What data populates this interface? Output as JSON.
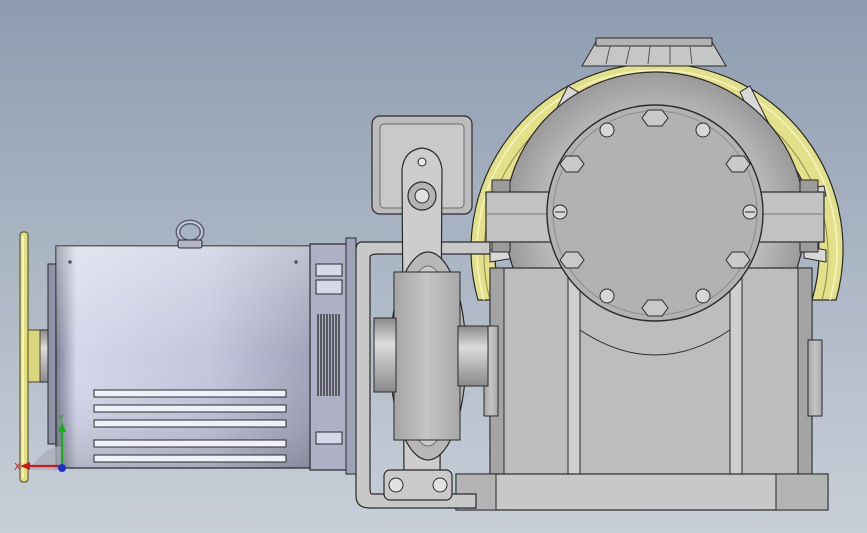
{
  "viewport": {
    "background_top": "#8d9cb0",
    "background_bottom": "#c8cfd8"
  },
  "colors": {
    "sheave_yellow": "#e3e08a",
    "motor_body": "#c9cbe0",
    "housing_gray": "#b9b9b9",
    "edge_dark": "#2a2a2a",
    "axis_x": "#d01818",
    "axis_y": "#18b018",
    "axis_z": "#1a2fd0"
  },
  "triad": {
    "x_label": "X",
    "y_label": "Y"
  },
  "parts": {
    "handwheel": "yellow-handwheel",
    "motor": "electric-motor",
    "eyebolt": "lifting-eyebolt",
    "brake": "drum-brake",
    "sheave": "traction-sheave",
    "gearbox": "gearbox-housing"
  }
}
